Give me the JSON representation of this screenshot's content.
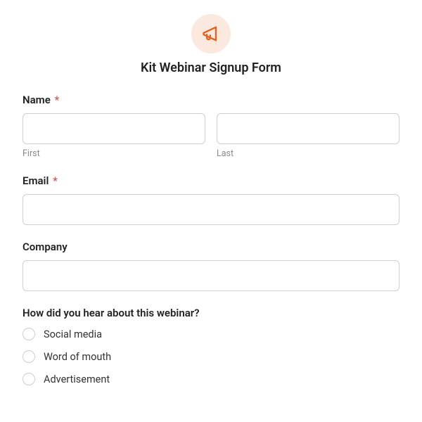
{
  "header": {
    "title": "Kit Webinar Signup Form",
    "icon": "megaphone-icon"
  },
  "fields": {
    "name": {
      "label": "Name",
      "required_mark": "*",
      "first_sublabel": "First",
      "last_sublabel": "Last"
    },
    "email": {
      "label": "Email",
      "required_mark": "*"
    },
    "company": {
      "label": "Company"
    },
    "referral": {
      "label": "How did you hear about this webinar?",
      "options": [
        "Social media",
        "Word of mouth",
        "Advertisement"
      ]
    }
  }
}
